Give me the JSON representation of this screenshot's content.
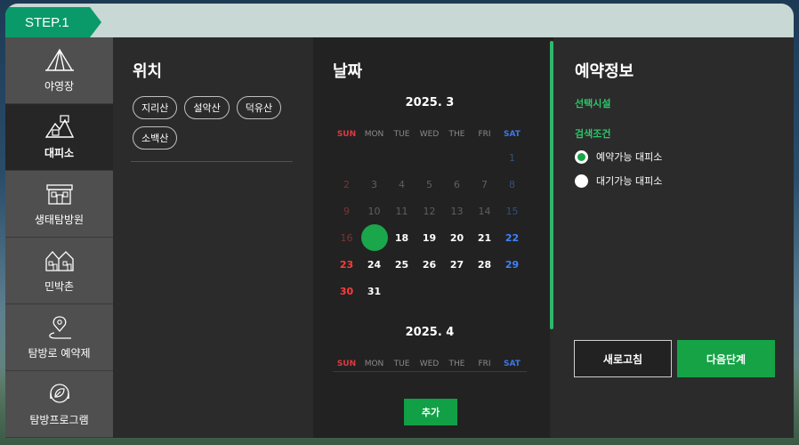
{
  "step": {
    "label": "STEP.1"
  },
  "sidebar": {
    "items": [
      {
        "label": "야영장",
        "icon": "tent-icon",
        "active": false
      },
      {
        "label": "대피소",
        "icon": "mountain-shelter-icon",
        "active": true
      },
      {
        "label": "생태탐방원",
        "icon": "eco-center-icon",
        "active": false
      },
      {
        "label": "민박촌",
        "icon": "village-icon",
        "active": false
      },
      {
        "label": "탐방로 예약제",
        "icon": "trail-pin-icon",
        "active": false
      },
      {
        "label": "탐방프로그램",
        "icon": "program-leaf-icon",
        "active": false
      }
    ]
  },
  "location": {
    "title": "위치",
    "chips": [
      "지리산",
      "설악산",
      "덕유산",
      "소백산"
    ]
  },
  "date": {
    "title": "날짜",
    "months": [
      {
        "title": "2025. 3",
        "weekdays": [
          "SUN",
          "MON",
          "TUE",
          "WED",
          "THE",
          "FRI",
          "SAT"
        ],
        "days": [
          "",
          "",
          "",
          "",
          "",
          "",
          "1",
          "2",
          "3",
          "4",
          "5",
          "6",
          "7",
          "8",
          "9",
          "10",
          "11",
          "12",
          "13",
          "14",
          "15",
          "16",
          "17",
          "18",
          "19",
          "20",
          "21",
          "22",
          "23",
          "24",
          "25",
          "26",
          "27",
          "28",
          "29",
          "30",
          "31",
          "",
          "",
          "",
          "",
          ""
        ],
        "today": "17",
        "first_available": "18"
      },
      {
        "title": "2025. 4",
        "weekdays": [
          "SUN",
          "MON",
          "TUE",
          "WED",
          "THE",
          "FRI",
          "SAT"
        ]
      }
    ],
    "add_label": "추가"
  },
  "info": {
    "title": "예약정보",
    "facility_label": "선택시설",
    "condition_label": "검색조건",
    "options": [
      {
        "label": "예약가능 대피소",
        "checked": true
      },
      {
        "label": "대기가능 대피소",
        "checked": false
      }
    ],
    "reset_label": "새로고침",
    "next_label": "다음단계"
  },
  "colors": {
    "accent": "#15a346",
    "step_badge": "#0a9a6a",
    "sunday": "#e0393e",
    "saturday": "#3a78e8"
  }
}
